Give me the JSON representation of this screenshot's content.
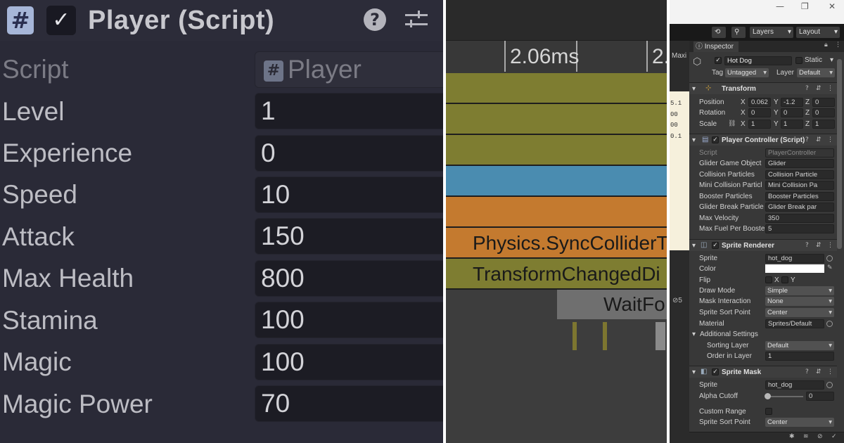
{
  "player_panel": {
    "title": "Player (Script)",
    "script_label": "Script",
    "script_value": "Player",
    "rows": [
      {
        "label": "Level",
        "value": "1"
      },
      {
        "label": "Experience",
        "value": "0"
      },
      {
        "label": "Speed",
        "value": "10"
      },
      {
        "label": "Attack",
        "value": "150"
      },
      {
        "label": "Max Health",
        "value": "800"
      },
      {
        "label": "Stamina",
        "value": "100"
      },
      {
        "label": "Magic",
        "value": "100"
      },
      {
        "label": "Magic Power",
        "value": "70"
      }
    ],
    "icons": {
      "script": "hash-icon",
      "enabled": "checkbox-icon",
      "help": "help-icon",
      "presets": "presets-icon"
    }
  },
  "profiler": {
    "time_label": "2.06ms",
    "time_label_partial": "2.",
    "bars": [
      {
        "label": "",
        "color": "#7e7d31"
      },
      {
        "label": "",
        "color": "#7e7d31"
      },
      {
        "label": "",
        "color": "#7e7d31"
      },
      {
        "label": "",
        "color": "#4a8cb0"
      },
      {
        "label": "",
        "color": "#c47a2f"
      },
      {
        "label": "Physics.SyncColliderT",
        "color": "#c47a2f"
      },
      {
        "label": "TransformChangedDi",
        "color": "#7e7d31"
      }
    ],
    "wait_label": "WaitFo"
  },
  "inspector": {
    "toolbar": {
      "layers": "Layers",
      "layout": "Layout"
    },
    "side_tab": "Maxi",
    "tab": "Inspector",
    "object": {
      "name": "Hot Dog",
      "static": "Static",
      "tag_label": "Tag",
      "tag": "Untagged",
      "layer_label": "Layer",
      "layer": "Default"
    },
    "transform": {
      "title": "Transform",
      "position_label": "Position",
      "position": {
        "x": "0.062",
        "y": "-1.2",
        "z": "0"
      },
      "rotation_label": "Rotation",
      "rotation": {
        "x": "0",
        "y": "0",
        "z": "0"
      },
      "scale_label": "Scale",
      "scale": {
        "x": "1",
        "y": "1",
        "z": "1"
      },
      "axis": {
        "x": "X",
        "y": "Y",
        "z": "Z"
      }
    },
    "player_controller": {
      "title": "Player Controller (Script)",
      "fields": [
        {
          "label": "Script",
          "value": "PlayerController"
        },
        {
          "label": "Glider Game Object",
          "value": "Glider"
        },
        {
          "label": "Collision Particles",
          "value": "Collision Particle"
        },
        {
          "label": "Mini Collision Particl",
          "value": "Mini Collision Pa"
        },
        {
          "label": "Booster Particles",
          "value": "Booster Particles"
        },
        {
          "label": "Glider Break Particle",
          "value": "Glider Break par"
        },
        {
          "label": "Max Velocity",
          "value": "350"
        },
        {
          "label": "Max Fuel Per Booste",
          "value": "5"
        }
      ]
    },
    "sprite_renderer": {
      "title": "Sprite Renderer",
      "sprite_label": "Sprite",
      "sprite": "hot_dog",
      "color_label": "Color",
      "color": "#ffffff",
      "flip_label": "Flip",
      "flip_x": "X",
      "flip_y": "Y",
      "draw_mode_label": "Draw Mode",
      "draw_mode": "Simple",
      "mask_label": "Mask Interaction",
      "mask": "None",
      "sort_point_label": "Sprite Sort Point",
      "sort_point": "Center",
      "material_label": "Material",
      "material": "Sprites/Default",
      "additional": "Additional Settings",
      "sorting_layer_label": "Sorting Layer",
      "sorting_layer": "Default",
      "order_label": "Order in Layer",
      "order": "1"
    },
    "sprite_mask": {
      "title": "Sprite Mask",
      "sprite_label": "Sprite",
      "sprite": "hot_dog",
      "alpha_label": "Alpha Cutoff",
      "alpha": "0",
      "custom_range_label": "Custom Range",
      "sort_point_label": "Sprite Sort Point",
      "sort_point": "Center"
    },
    "left_strip": {
      "nums": [
        "5.1",
        "00",
        "00",
        "0.1"
      ],
      "badge": "5"
    }
  }
}
